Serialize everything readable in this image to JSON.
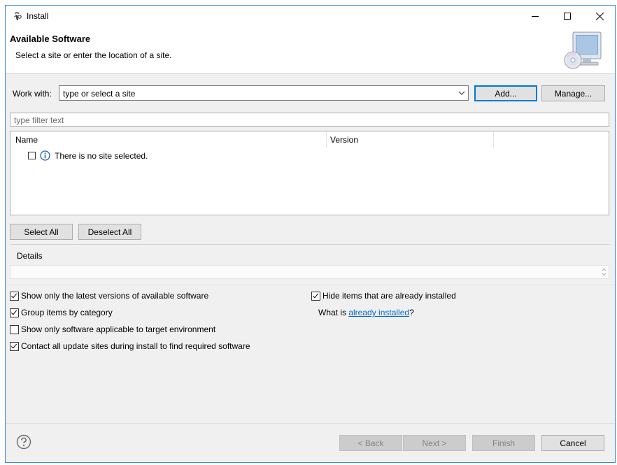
{
  "window": {
    "title": "Install"
  },
  "header": {
    "title": "Available Software",
    "description": "Select a site or enter the location of a site."
  },
  "work_with": {
    "label": "Work with:",
    "value": "type or select a site",
    "add_label": "Add...",
    "manage_label": "Manage..."
  },
  "filter": {
    "placeholder": "type filter text"
  },
  "tree": {
    "columns": [
      "Name",
      "Version"
    ],
    "rows": [
      {
        "label": "There is no site selected.",
        "checked": false
      }
    ]
  },
  "selection": {
    "select_all": "Select All",
    "deselect_all": "Deselect All"
  },
  "details": {
    "label": "Details"
  },
  "options": {
    "show_latest": {
      "label": "Show only the latest versions of available software",
      "checked": true
    },
    "group_by_category": {
      "label": "Group items by category",
      "checked": true
    },
    "applicable_only": {
      "label": "Show only software applicable to target environment",
      "checked": false
    },
    "contact_all_sites": {
      "label": "Contact all update sites during install to find required software",
      "checked": true
    },
    "hide_installed": {
      "label": "Hide items that are already installed",
      "checked": true
    },
    "what_is_prefix": "What is ",
    "what_is_link": "already installed",
    "what_is_suffix": "?"
  },
  "footer": {
    "back": "< Back",
    "next": "Next >",
    "finish": "Finish",
    "cancel": "Cancel"
  },
  "colors": {
    "accent": "#0078d7",
    "link": "#0066cc",
    "info_icon": "#1c64b4"
  }
}
